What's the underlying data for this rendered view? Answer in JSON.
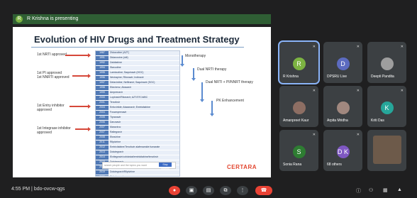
{
  "presenting": {
    "avatar": "R",
    "text": "R Krishna is presenting"
  },
  "slide": {
    "title": "Evolution of HIV Drugs and Treatment Strategy",
    "left_labels": [
      "1st NRTI approved",
      "1st PI approved\n1st NNRTI approved",
      "1st Entry inhibitor\napproved",
      "1st Integrase inhibitor\napproved"
    ],
    "table_rows": [
      {
        "y": "1987",
        "d": "Zidovudine (AZT)"
      },
      {
        "y": "1991",
        "d": "Didanosine (ddI)"
      },
      {
        "y": "1992",
        "d": "Zalcitabine"
      },
      {
        "y": "1994",
        "d": "Stavudine"
      },
      {
        "y": "1995",
        "d": "Lamivudine; Saquinavir (HGC)"
      },
      {
        "y": "1996",
        "d": "Nevirapine; Ritonavir; Indinavir"
      },
      {
        "y": "1997",
        "d": "Delavirdine; Nelfinavir; Saquinavir (SGC)"
      },
      {
        "y": "1998",
        "d": "Efavirenz; Abacavir"
      },
      {
        "y": "1999",
        "d": "Amprenavir"
      },
      {
        "y": "2000",
        "d": "Lopinavir/Ritonavir; AZT/3TC/ABC"
      },
      {
        "y": "2001",
        "d": "Tenofovir"
      },
      {
        "y": "2003",
        "d": "Enfuvirtide; Atazanavir; Emtricitabine"
      },
      {
        "y": "2004",
        "d": "Fosamprenavir"
      },
      {
        "y": "2005",
        "d": "Tipranavir"
      },
      {
        "y": "2006",
        "d": "Darunavir"
      },
      {
        "y": "2007",
        "d": "Maraviroc"
      },
      {
        "y": "2007",
        "d": "Raltegravir"
      },
      {
        "y": "2008",
        "d": "Etravirine"
      },
      {
        "y": "2011",
        "d": "Rilpivirine"
      },
      {
        "y": "2012",
        "d": "Emtricitabine/Tenofovir alafenamide fumarate"
      },
      {
        "y": "2013",
        "d": "Dolutegravir"
      },
      {
        "y": "2014",
        "d": "Elvitegravir/cobicistat/emtricitabine/tenofovir"
      },
      {
        "y": "2015",
        "d": "Dolutegravir"
      },
      {
        "y": "2018",
        "d": "Bictegravir/Emtricitabine/Tenofovir"
      },
      {
        "y": "2019",
        "d": "Dolutegravir/Rilpivirine"
      },
      {
        "y": "2020",
        "d": "Cabotegravir"
      }
    ],
    "stages": [
      "Monotherapy",
      "Dual NRTI therapy",
      "Dual NRTI + PI/NNRT therapy",
      "PK Enhancement"
    ],
    "search_placeholder": "search people and the topics you want",
    "search_button": "Stop sharing",
    "logo": "CERTARA"
  },
  "participants": [
    {
      "name": "R Krishna",
      "initial": "R",
      "color": "#7cb342",
      "active": true
    },
    {
      "name": "DPSRU Live",
      "initial": "D",
      "color": "#5c6bc0"
    },
    {
      "name": "Deepti Pandita",
      "initial": "",
      "color": "#9e9e9e"
    },
    {
      "name": "Amanpreet Kaur",
      "initial": "",
      "color": "#8d6e63"
    },
    {
      "name": "Arpita Mridha",
      "initial": "",
      "color": "#a1887f"
    },
    {
      "name": "Kriti Das",
      "initial": "K",
      "color": "#26a69a"
    },
    {
      "name": "Sonia Rana",
      "initial": "S",
      "color": "#2e7d32"
    },
    {
      "name": "68 others",
      "initial": "D K",
      "color": "#7e57c2"
    },
    {
      "name": "",
      "initial": "",
      "color": "#6d5a4a"
    }
  ],
  "meeting": {
    "time": "4:55 PM",
    "separator": "|",
    "code": "bdo-ovcw-qgs"
  }
}
